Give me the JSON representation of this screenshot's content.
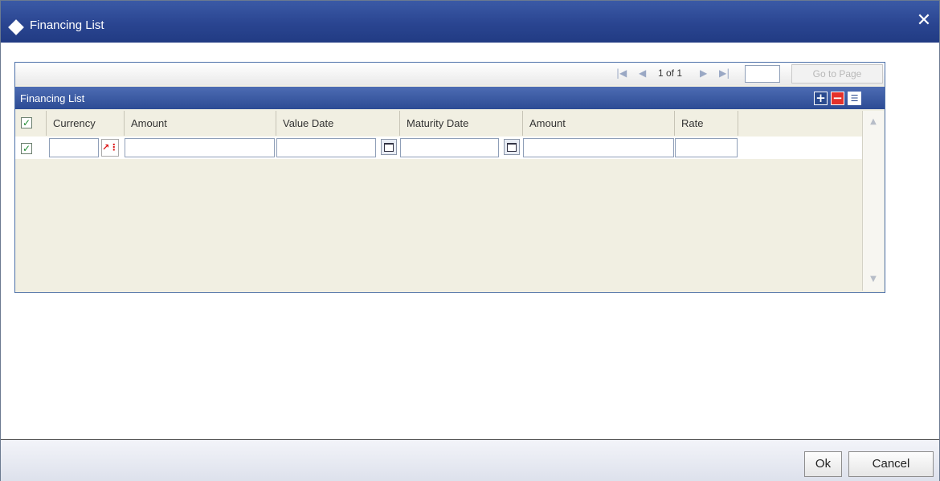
{
  "window": {
    "title": "Financing List",
    "close_icon": "close-icon"
  },
  "pager": {
    "first_icon": "first-page-icon",
    "prev_icon": "prev-page-icon",
    "page_text": "1 of 1",
    "next_icon": "next-page-icon",
    "last_icon": "last-page-icon",
    "page_input_value": "",
    "goto_label": "Go to Page"
  },
  "section": {
    "title": "Financing List",
    "add_icon": "add-row-icon",
    "delete_icon": "delete-row-icon",
    "view_icon": "single-view-icon"
  },
  "grid": {
    "columns": [
      "Currency",
      "Amount",
      "Value Date",
      "Maturity Date",
      "Amount",
      "Rate"
    ],
    "rows": [
      {
        "checked": true,
        "currency": "",
        "amount": "",
        "value_date": "",
        "maturity_date": "",
        "amount2": "",
        "rate": ""
      }
    ],
    "header_checked": true
  },
  "footer": {
    "ok_label": "Ok",
    "cancel_label": "Cancel"
  },
  "colors": {
    "title_bar": "#2a4591",
    "section_bar": "#3a5aa2",
    "grid_bg": "#f1efe2",
    "delete_red": "#e4322b"
  }
}
